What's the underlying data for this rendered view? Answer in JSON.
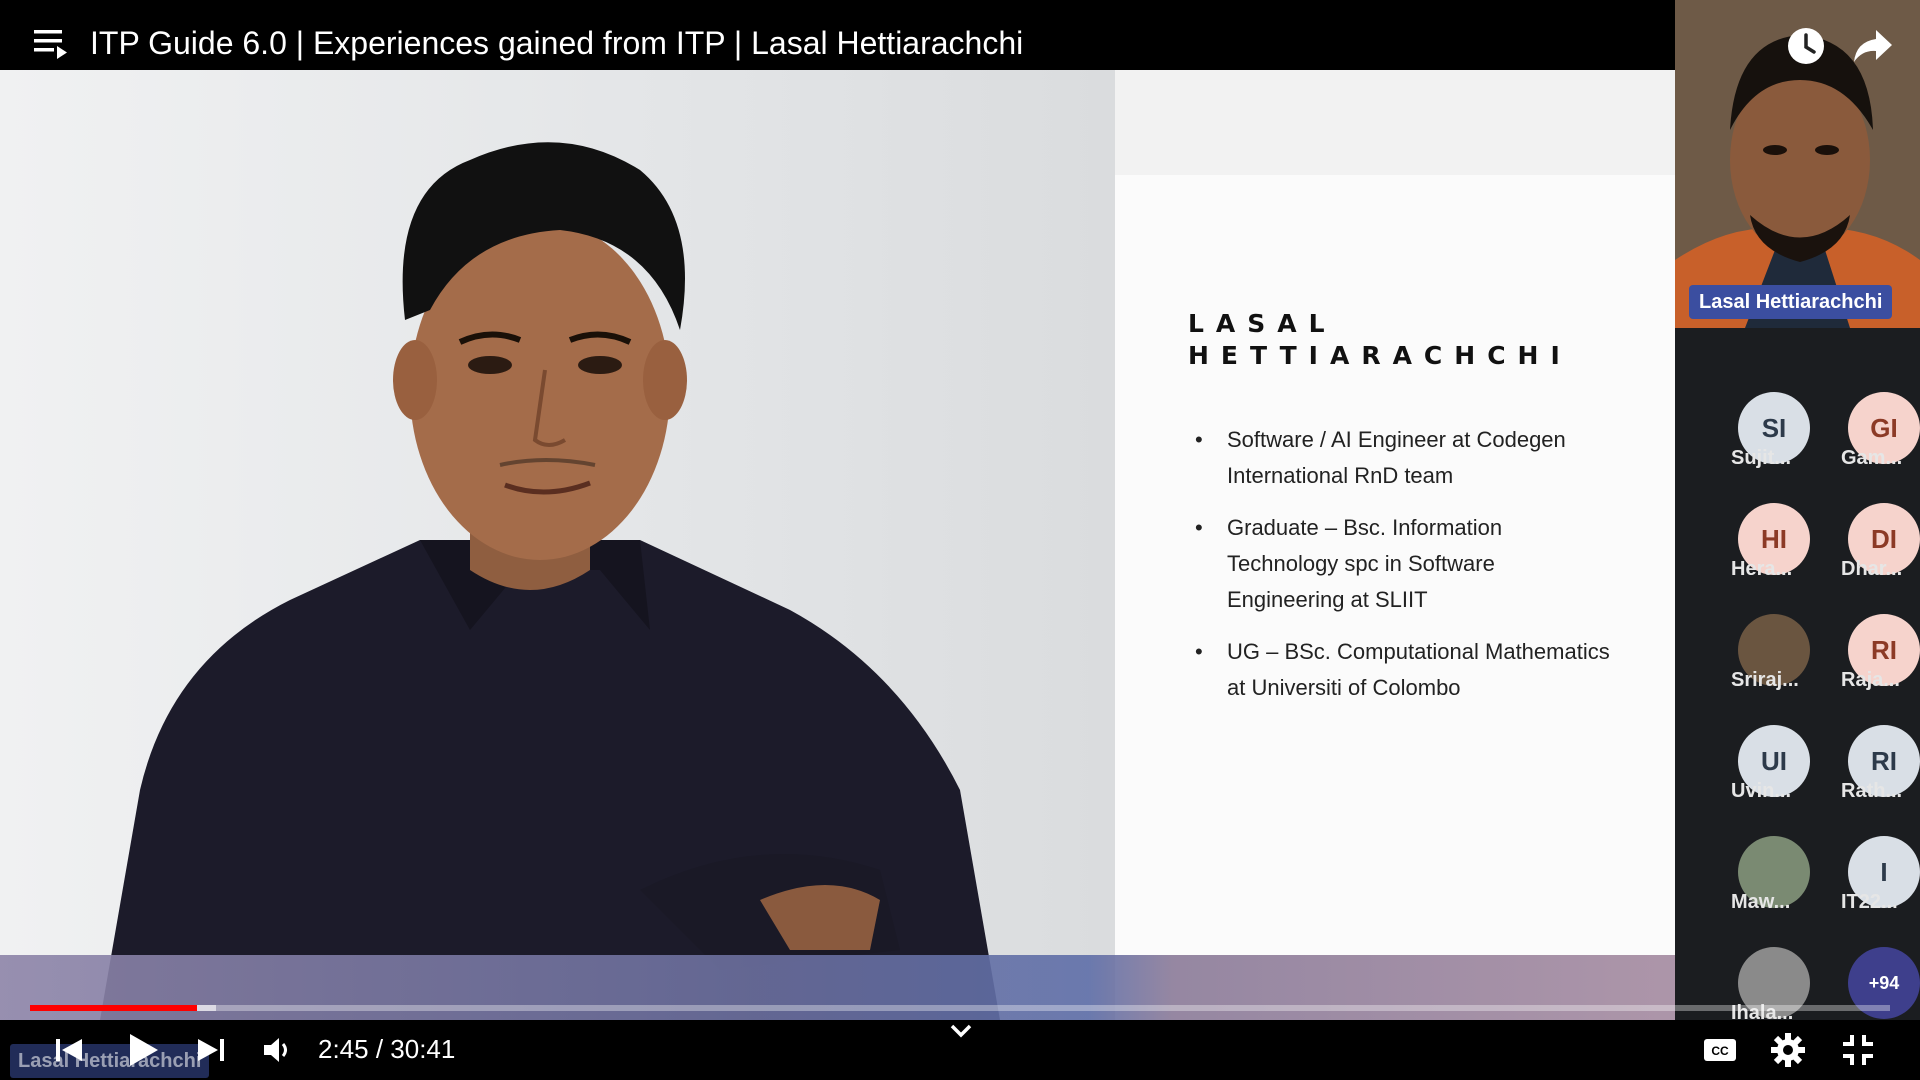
{
  "player": {
    "title": "ITP Guide 6.0 | Experiences gained from ITP | Lasal Hettiarachchi",
    "time": "2:45 / 30:41",
    "progress_played": 0.0896,
    "progress_buffered": 0.1,
    "accent_color": "#ff0000"
  },
  "slide": {
    "name_line1": "LASAL",
    "name_line2": "HETTIARACHCHI",
    "bullets": [
      "Software / AI Engineer at Codegen International RnD team",
      "Graduate – Bsc. Information Technology spc in Software Engineering at SLIIT",
      "UG – BSc. Computational Mathematics at Universiti of Colombo"
    ]
  },
  "meeting": {
    "speaker_label": "Lasal Hettiarachchi",
    "name_overlay": "Lasal Hettiarachchi",
    "participants": [
      {
        "initials": "SI",
        "name": "Sujit...",
        "bg": "#d9dfe6",
        "fg": "#2d3a4a"
      },
      {
        "initials": "GI",
        "name": "Gam...",
        "bg": "#f6d3cc",
        "fg": "#8c3a26"
      },
      {
        "initials": "HI",
        "name": "Hera...",
        "bg": "#f6d3cc",
        "fg": "#8c3a26"
      },
      {
        "initials": "DI",
        "name": "Dhar...",
        "bg": "#f6d3cc",
        "fg": "#8c3a26"
      },
      {
        "initials": "",
        "name": "Sriraj...",
        "bg": "#6a5540",
        "fg": "#ffffff"
      },
      {
        "initials": "RI",
        "name": "Raja...",
        "bg": "#f6d3cc",
        "fg": "#8c3a26"
      },
      {
        "initials": "UI",
        "name": "Uvin...",
        "bg": "#d9dfe6",
        "fg": "#2d3a4a"
      },
      {
        "initials": "RI",
        "name": "Rath...",
        "bg": "#d9dfe6",
        "fg": "#2d3a4a"
      },
      {
        "initials": "",
        "name": "Maw...",
        "bg": "#7a8a72",
        "fg": "#ffffff"
      },
      {
        "initials": "I",
        "name": "IT22...",
        "bg": "#d9dfe6",
        "fg": "#2d3a4a"
      },
      {
        "initials": "",
        "name": "Ihala...",
        "bg": "#8a8a8a",
        "fg": "#ffffff"
      },
      {
        "initials": "+94",
        "name": "",
        "bg": "#3e3f8c",
        "fg": "#ffffff"
      }
    ]
  },
  "icons": {
    "playlist": "playlist-icon",
    "watch_later": "clock-icon",
    "share": "share-icon",
    "prev": "skip-previous-icon",
    "play": "play-icon",
    "next": "skip-next-icon",
    "volume": "volume-icon",
    "chevron": "chevron-down-icon",
    "captions": "captions-icon",
    "settings": "gear-icon",
    "exit_fullscreen": "exit-fullscreen-icon"
  }
}
